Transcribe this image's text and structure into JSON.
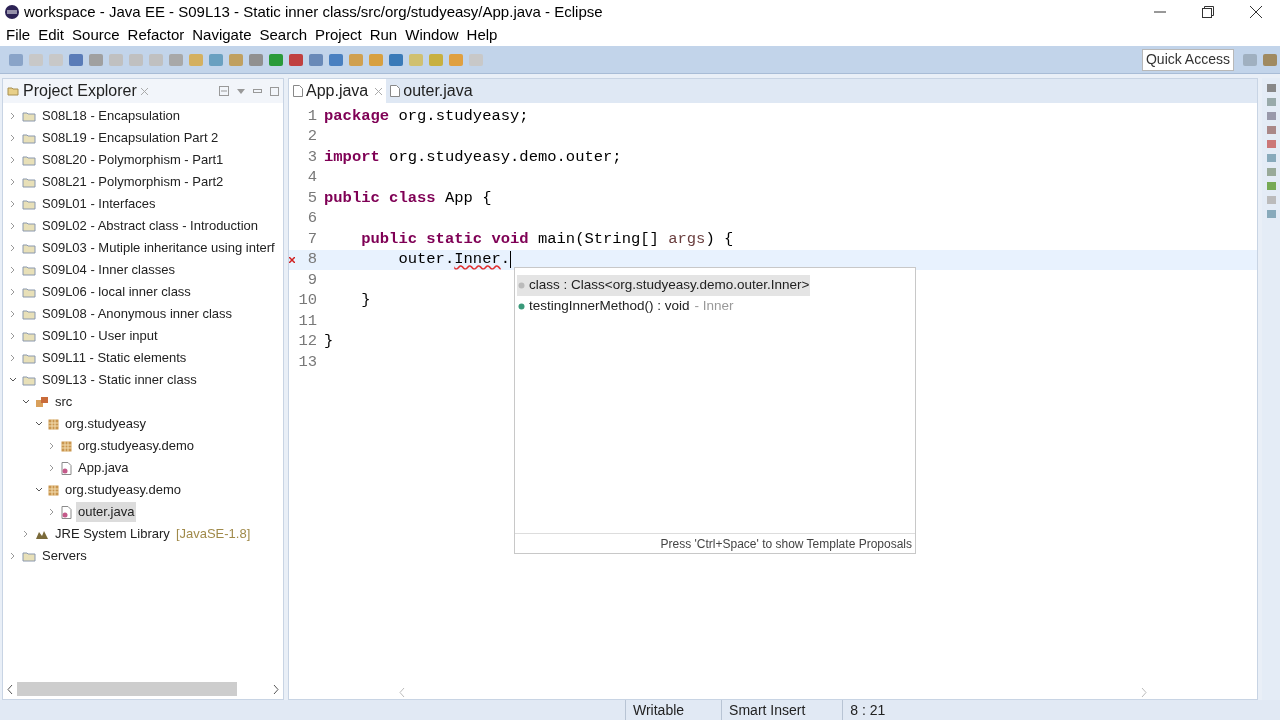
{
  "window": {
    "title": "workspace - Java EE - S09L13 - Static inner class/src/org/studyeasy/App.java - Eclipse"
  },
  "menu": [
    "File",
    "Edit",
    "Source",
    "Refactor",
    "Navigate",
    "Search",
    "Project",
    "Run",
    "Window",
    "Help"
  ],
  "quick_access": {
    "placeholder": "Quick Access"
  },
  "project_explorer": {
    "title": "Project Explorer",
    "items": [
      {
        "label": "S08L18 - Encapsulation",
        "kind": "project",
        "expanded": false,
        "selected": false
      },
      {
        "label": "S08L19 - Encapsulation Part 2",
        "kind": "project",
        "expanded": false,
        "selected": false
      },
      {
        "label": "S08L20 - Polymorphism - Part1",
        "kind": "project",
        "expanded": false,
        "selected": false
      },
      {
        "label": "S08L21 - Polymorphism - Part2",
        "kind": "project",
        "expanded": false,
        "selected": false
      },
      {
        "label": "S09L01 - Interfaces",
        "kind": "project",
        "expanded": false,
        "selected": false
      },
      {
        "label": "S09L02 - Abstract class - Introduction",
        "kind": "project",
        "expanded": false,
        "selected": false
      },
      {
        "label": "S09L03 - Mutiple inheritance using interf",
        "kind": "project",
        "expanded": false,
        "selected": false
      },
      {
        "label": "S09L04 - Inner classes",
        "kind": "project",
        "expanded": false,
        "selected": false
      },
      {
        "label": "S09L06 - local inner class",
        "kind": "project",
        "expanded": false,
        "selected": false
      },
      {
        "label": "S09L08 - Anonymous inner class",
        "kind": "project",
        "expanded": false,
        "selected": false
      },
      {
        "label": "S09L10 - User input",
        "kind": "project",
        "expanded": false,
        "selected": false
      },
      {
        "label": "S09L11 - Static elements",
        "kind": "project",
        "expanded": false,
        "selected": false
      },
      {
        "label": "S09L13 - Static inner class",
        "kind": "project",
        "expanded": true,
        "selected": false,
        "children": [
          {
            "label": "src",
            "kind": "source",
            "expanded": true,
            "selected": false,
            "children": [
              {
                "label": "org.studyeasy",
                "kind": "package",
                "expanded": true,
                "selected": false,
                "children": [
                  {
                    "label": "org.studyeasy.demo",
                    "kind": "package",
                    "expanded": false,
                    "selected": false
                  },
                  {
                    "label": "App.java",
                    "kind": "file",
                    "expanded": false,
                    "selected": false
                  }
                ]
              },
              {
                "label": "org.studyeasy.demo",
                "kind": "package",
                "expanded": true,
                "selected": false,
                "children": [
                  {
                    "label": "outer.java",
                    "kind": "file",
                    "expanded": false,
                    "selected": true
                  }
                ]
              }
            ]
          },
          {
            "label": "JRE System Library",
            "suffix": "[JavaSE-1.8]",
            "kind": "library",
            "expanded": false,
            "selected": false
          }
        ]
      },
      {
        "label": "Servers",
        "kind": "project",
        "expanded": false,
        "selected": false
      }
    ]
  },
  "editor_tabs": [
    {
      "label": "App.java",
      "selected": true
    },
    {
      "label": "outer.java",
      "selected": false
    }
  ],
  "code_lines": [
    {
      "number": "1",
      "tokens": [
        {
          "text": "package",
          "kind": "keyword"
        },
        {
          "text": " org.studyeasy;",
          "kind": "plain"
        }
      ]
    },
    {
      "number": "2"
    },
    {
      "number": "3",
      "tokens": [
        {
          "text": "import",
          "kind": "keyword"
        },
        {
          "text": " org.studyeasy.demo.outer;",
          "kind": "plain"
        }
      ]
    },
    {
      "number": "4"
    },
    {
      "number": "5",
      "tokens": [
        {
          "text": "public class",
          "kind": "keyword"
        },
        {
          "text": " App {",
          "kind": "plain"
        }
      ]
    },
    {
      "number": "6"
    },
    {
      "number": "7",
      "tokens": [
        {
          "text": "    public static void",
          "kind": "keyword"
        },
        {
          "text": " main(String[] ",
          "kind": "plain"
        },
        {
          "text": "args",
          "kind": "param"
        },
        {
          "text": ") {",
          "kind": "plain"
        }
      ]
    },
    {
      "number": "8",
      "current": true,
      "error": true,
      "tokens": [
        {
          "text": "        outer.",
          "kind": "plain"
        },
        {
          "text": "Inner",
          "kind": "error"
        },
        {
          "text": ".",
          "kind": "plain"
        }
      ]
    },
    {
      "number": "9"
    },
    {
      "number": "10",
      "tokens": [
        {
          "text": "    }",
          "kind": "plain"
        }
      ]
    },
    {
      "number": "11"
    },
    {
      "number": "12",
      "tokens": [
        {
          "text": "}",
          "kind": "plain"
        }
      ]
    },
    {
      "number": "13"
    }
  ],
  "completion_popup": {
    "proposals": [
      {
        "text": "class : Class<org.studyeasy.demo.outer.Inner>",
        "selected": true
      },
      {
        "text": "testingInnerMethod() : void",
        "qualifier": "- Inner",
        "selected": false
      }
    ],
    "footer": "Press 'Ctrl+Space' to show Template Proposals"
  },
  "status_bar": [
    "Writable",
    "Smart Insert",
    "8 : 21"
  ]
}
